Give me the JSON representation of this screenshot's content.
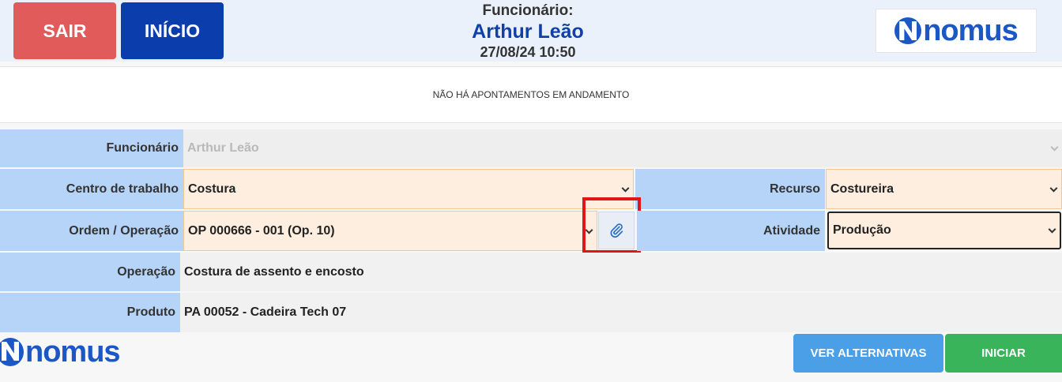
{
  "header": {
    "exit_label": "SAIR",
    "home_label": "INÍCIO",
    "employee_caption": "Funcionário:",
    "employee_name": "Arthur Leão",
    "datetime": "27/08/24 10:50",
    "logo_text": "nomus"
  },
  "status_message": "NÃO HÁ APONTAMENTOS EM ANDAMENTO",
  "form": {
    "funcionario": {
      "label": "Funcionário",
      "value": "Arthur Leão"
    },
    "centro_trabalho": {
      "label": "Centro de trabalho",
      "value": "Costura"
    },
    "recurso": {
      "label": "Recurso",
      "value": "Costureira"
    },
    "ordem_operacao": {
      "label": "Ordem / Operação",
      "value": "OP 000666 - 001 (Op. 10)"
    },
    "atividade": {
      "label": "Atividade",
      "value": "Produção"
    },
    "operacao": {
      "label": "Operação",
      "value": "Costura de assento e encosto"
    },
    "produto": {
      "label": "Produto",
      "value": "PA 00052 - Cadeira Tech 07"
    }
  },
  "footer": {
    "logo_text": "nomus",
    "alternatives_label": "VER ALTERNATIVAS",
    "start_label": "INICIAR"
  },
  "colors": {
    "exit": "#e25b5b",
    "home": "#0b3dac",
    "alternatives": "#4a9fe7",
    "start": "#3ab45a",
    "highlight": "#e01515"
  }
}
